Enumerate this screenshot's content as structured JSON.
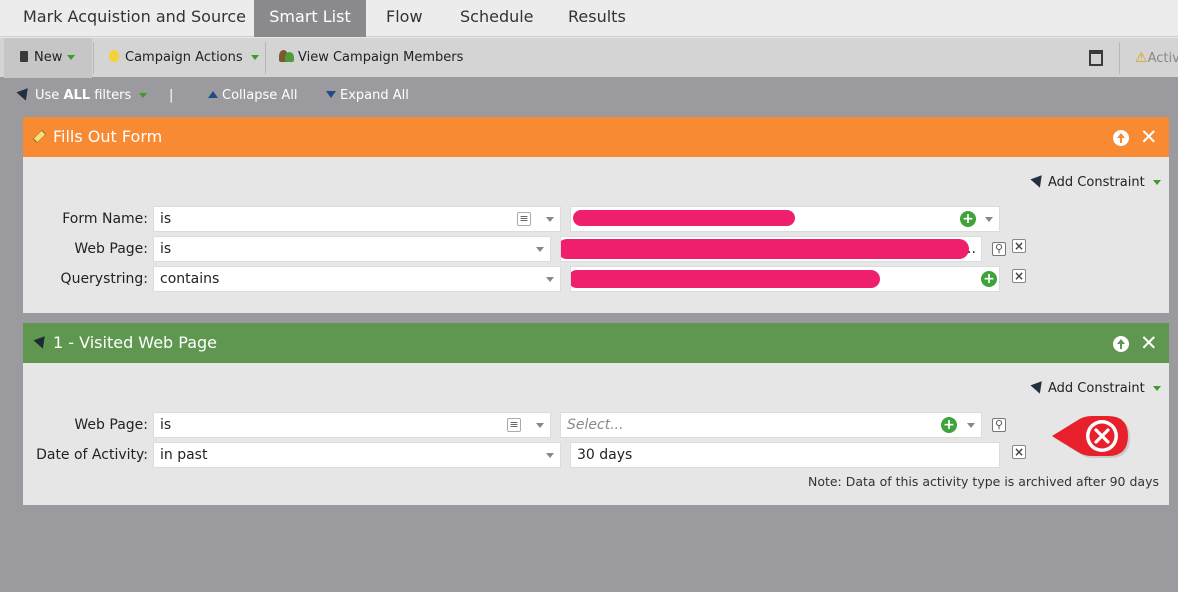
{
  "tabs": [
    {
      "label": "Mark Acquistion and Source"
    },
    {
      "label": "Smart List"
    },
    {
      "label": "Flow"
    },
    {
      "label": "Schedule"
    },
    {
      "label": "Results"
    }
  ],
  "toolbar": {
    "new_label": "New",
    "campaign_actions_label": "Campaign Actions",
    "view_members_label": "View Campaign Members",
    "activity_label": "Activ"
  },
  "filterbar": {
    "use_label": "Use",
    "all_label": "ALL",
    "filters_label": "filters",
    "separator": "|",
    "collapse_label": "Collapse All",
    "expand_label": "Expand All"
  },
  "filter1": {
    "title": "Fills Out Form",
    "add_constraint": "Add Constraint",
    "rows": [
      {
        "label": "Form Name:",
        "operator": "is"
      },
      {
        "label": "Web Page:",
        "operator": "is",
        "value_suffix": ".."
      },
      {
        "label": "Querystring:",
        "operator": "contains"
      }
    ],
    "colors": {
      "header": "#f78a33"
    }
  },
  "filter2": {
    "title": "1 - Visited Web Page",
    "add_constraint": "Add Constraint",
    "rows": [
      {
        "label": "Web Page:",
        "operator": "is",
        "placeholder": "Select..."
      },
      {
        "label": "Date of Activity:",
        "operator": "in past",
        "value": "30 days"
      }
    ],
    "note": "Note: Data of this activity type is archived after 90 days",
    "colors": {
      "header": "#5f9650"
    }
  },
  "annotation": {
    "icon": "x-circle-icon",
    "color": "#e8202b"
  }
}
